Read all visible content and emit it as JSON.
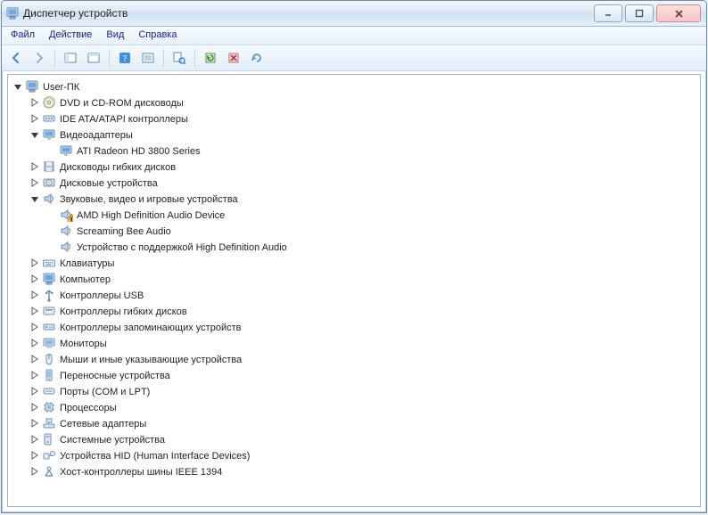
{
  "window": {
    "title": "Диспетчер устройств"
  },
  "menu": {
    "file": "Файл",
    "action": "Действие",
    "view": "Вид",
    "help": "Справка"
  },
  "tree": {
    "root": "User-ПК",
    "items": [
      {
        "expand": "closed",
        "icon": "disc",
        "label": "DVD и CD-ROM дисководы"
      },
      {
        "expand": "closed",
        "icon": "ide",
        "label": "IDE ATA/ATAPI контроллеры"
      },
      {
        "expand": "open",
        "icon": "display",
        "label": "Видеоадаптеры",
        "children": [
          {
            "icon": "display",
            "label": "ATI Radeon HD 3800 Series"
          }
        ]
      },
      {
        "expand": "closed",
        "icon": "floppy",
        "label": "Дисководы гибких дисков"
      },
      {
        "expand": "closed",
        "icon": "hdd",
        "label": "Дисковые устройства"
      },
      {
        "expand": "open",
        "icon": "sound",
        "label": "Звуковые, видео и игровые устройства",
        "children": [
          {
            "icon": "sound",
            "warning": true,
            "label": "AMD High Definition Audio Device"
          },
          {
            "icon": "sound",
            "label": "Screaming Bee Audio"
          },
          {
            "icon": "sound",
            "label": "Устройство с поддержкой High Definition Audio"
          }
        ]
      },
      {
        "expand": "closed",
        "icon": "keyboard",
        "label": "Клавиатуры"
      },
      {
        "expand": "closed",
        "icon": "computer",
        "label": "Компьютер"
      },
      {
        "expand": "closed",
        "icon": "usb",
        "label": "Контроллеры USB"
      },
      {
        "expand": "closed",
        "icon": "floppyc",
        "label": "Контроллеры гибких дисков"
      },
      {
        "expand": "closed",
        "icon": "storage",
        "label": "Контроллеры запоминающих устройств"
      },
      {
        "expand": "closed",
        "icon": "monitor",
        "label": "Мониторы"
      },
      {
        "expand": "closed",
        "icon": "mouse",
        "label": "Мыши и иные указывающие устройства"
      },
      {
        "expand": "closed",
        "icon": "portable",
        "label": "Переносные устройства"
      },
      {
        "expand": "closed",
        "icon": "port",
        "label": "Порты (COM и LPT)"
      },
      {
        "expand": "closed",
        "icon": "cpu",
        "label": "Процессоры"
      },
      {
        "expand": "closed",
        "icon": "net",
        "label": "Сетевые адаптеры"
      },
      {
        "expand": "closed",
        "icon": "system",
        "label": "Системные устройства"
      },
      {
        "expand": "closed",
        "icon": "hid",
        "label": "Устройства HID (Human Interface Devices)"
      },
      {
        "expand": "closed",
        "icon": "ieee",
        "label": "Хост-контроллеры шины IEEE 1394"
      }
    ]
  }
}
